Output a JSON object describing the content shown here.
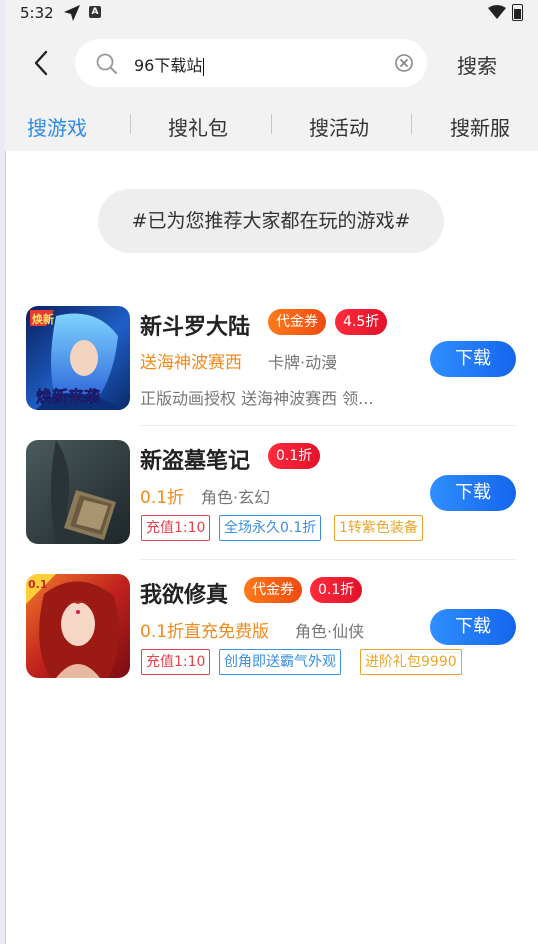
{
  "status": {
    "time": "5:32"
  },
  "search": {
    "query": "96下载站",
    "button_label": "搜索"
  },
  "tabs": [
    {
      "label": "搜游戏",
      "active": true
    },
    {
      "label": "搜礼包",
      "active": false
    },
    {
      "label": "搜活动",
      "active": false
    },
    {
      "label": "搜新服",
      "active": false
    }
  ],
  "recommend_text": "#已为您推荐大家都在玩的游戏#",
  "games": [
    {
      "title": "新斗罗大陆",
      "badges": [
        "代金券",
        "4.5折"
      ],
      "highlight": "送海神波赛西",
      "category": "卡牌·动漫",
      "description": "正版动画授权 送海神波赛西 领...",
      "tags": [],
      "download_label": "下载",
      "icon_text": "焕新来袭",
      "icon_corner": "焕新"
    },
    {
      "title": "新盗墓笔记",
      "badges": [
        "0.1折"
      ],
      "highlight": "0.1折",
      "category": "角色·玄幻",
      "description": "",
      "tags": [
        "充值1:10",
        "全场永久0.1折",
        "1转紫色装备"
      ],
      "download_label": "下载",
      "icon_text": "",
      "icon_corner": ""
    },
    {
      "title": "我欲修真",
      "badges": [
        "代金券",
        "0.1折"
      ],
      "highlight": "0.1折直充免费版",
      "category": "角色·仙侠",
      "description": "",
      "tags": [
        "充值1:10",
        "创角即送霸气外观",
        "进阶礼包9990"
      ],
      "download_label": "下载",
      "icon_text": "",
      "icon_corner": "0.1"
    }
  ]
}
